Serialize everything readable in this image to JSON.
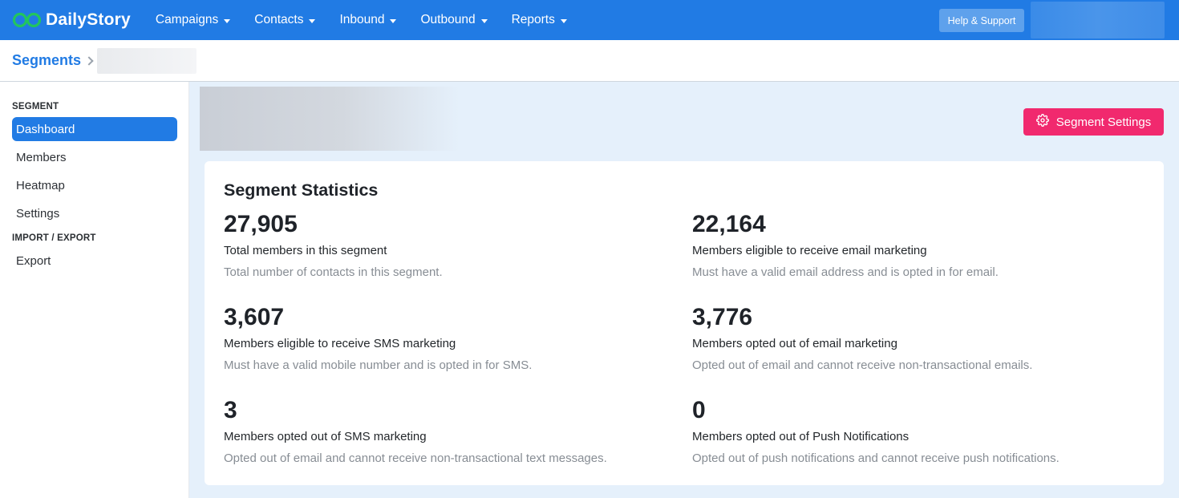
{
  "brand": {
    "name": "DailyStory"
  },
  "nav": {
    "items": [
      {
        "label": "Campaigns"
      },
      {
        "label": "Contacts"
      },
      {
        "label": "Inbound"
      },
      {
        "label": "Outbound"
      },
      {
        "label": "Reports"
      }
    ],
    "help_label": "Help & Support"
  },
  "breadcrumb": {
    "root": "Segments"
  },
  "sidebar": {
    "section1": "SEGMENT",
    "items": [
      {
        "label": "Dashboard",
        "active": true
      },
      {
        "label": "Members"
      },
      {
        "label": "Heatmap"
      },
      {
        "label": "Settings"
      }
    ],
    "section2": "IMPORT / EXPORT",
    "items2": [
      {
        "label": "Export"
      }
    ]
  },
  "main": {
    "settings_button": "Segment Settings",
    "card_title": "Segment Statistics",
    "stats": [
      {
        "value": "27,905",
        "label": "Total members in this segment",
        "desc": "Total number of contacts in this segment."
      },
      {
        "value": "22,164",
        "label": "Members eligible to receive email marketing",
        "desc": "Must have a valid email address and is opted in for email."
      },
      {
        "value": "3,607",
        "label": "Members eligible to receive SMS marketing",
        "desc": "Must have a valid mobile number and is opted in for SMS."
      },
      {
        "value": "3,776",
        "label": "Members opted out of email marketing",
        "desc": "Opted out of email and cannot receive non-transactional emails."
      },
      {
        "value": "3",
        "label": "Members opted out of SMS marketing",
        "desc": "Opted out of email and cannot receive non-transactional text messages."
      },
      {
        "value": "0",
        "label": "Members opted out of Push Notifications",
        "desc": "Opted out of push notifications and cannot receive push notifications."
      }
    ]
  },
  "colors": {
    "primary": "#217be4",
    "accent": "#f1296e",
    "logo_green": "#22c55e",
    "main_bg": "#e5f0fb"
  },
  "icons": {
    "logo": "infinity-logo-icon",
    "settings": "gear-icon",
    "caret": "caret-down-icon",
    "breadcrumb_sep": "chevron-right-icon"
  }
}
